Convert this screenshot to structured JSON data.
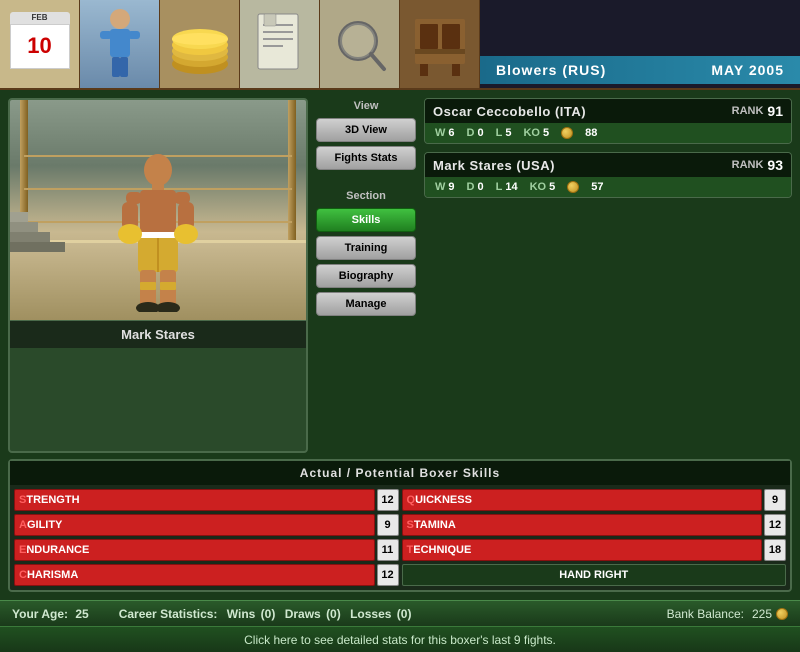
{
  "nav": {
    "calendar_month": "FEB",
    "calendar_day": "10",
    "title_left": "Blowers (RUS)",
    "title_right": "MAY 2005"
  },
  "boxer_preview": {
    "name": "Mark Stares"
  },
  "view_section": {
    "view_label": "View",
    "btn_3d": "3D View",
    "btn_fights": "Fights Stats",
    "section_label": "Section",
    "btn_skills": "Skills",
    "btn_training": "Training",
    "btn_biography": "Biography",
    "btn_manage": "Manage"
  },
  "opponents": [
    {
      "name": "Oscar Ceccobello (ITA)",
      "rank_label": "RANK",
      "rank": "91",
      "w": "6",
      "d": "0",
      "l": "5",
      "ko": "5",
      "coins": "88"
    },
    {
      "name": "Mark Stares (USA)",
      "rank_label": "RANK",
      "rank": "93",
      "w": "9",
      "d": "0",
      "l": "14",
      "ko": "5",
      "coins": "57"
    }
  ],
  "skills": {
    "header": "Actual / Potential Boxer Skills",
    "items": [
      {
        "name": "STRENGTH",
        "first": "S",
        "rest": "TRENGTH",
        "value": "12",
        "type": "red"
      },
      {
        "name": "QUICKNESS",
        "first": "Q",
        "rest": "UICKNESS",
        "value": "9",
        "type": "red"
      },
      {
        "name": "AGILITY",
        "first": "A",
        "rest": "GILITY",
        "value": "9",
        "type": "red"
      },
      {
        "name": "STAMINA",
        "first": "S",
        "rest": "TAMINA",
        "value": "12",
        "type": "red"
      },
      {
        "name": "ENDURANCE",
        "first": "E",
        "rest": "NDURANCE",
        "value": "11",
        "type": "red"
      },
      {
        "name": "TECHNIQUE",
        "first": "T",
        "rest": "ECHNIQUE",
        "value": "18",
        "type": "red"
      },
      {
        "name": "CHARISMA",
        "first": "C",
        "rest": "HARISMA",
        "value": "12",
        "type": "red"
      },
      {
        "name": "HAND RIGHT",
        "first": "",
        "rest": "HAND RIGHT",
        "value": "",
        "type": "neutral"
      }
    ]
  },
  "status_bar": {
    "age_label": "Your Age:",
    "age_value": "25",
    "career_label": "Career Statistics:",
    "wins_label": "Wins",
    "wins": "(0)",
    "draws_label": "Draws",
    "draws": "(0)",
    "losses_label": "Losses",
    "losses": "(0)",
    "bank_label": "Bank Balance:",
    "bank_value": "225"
  },
  "info_bar": {
    "text": "Click here to see detailed stats for this boxer's last 9 fights."
  }
}
